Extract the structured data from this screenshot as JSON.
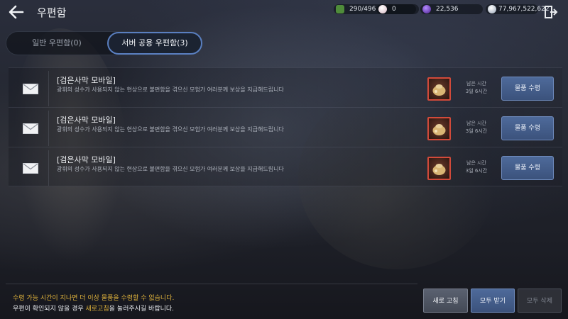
{
  "header": {
    "title": "우편함",
    "resources": [
      {
        "icon": "energy-icon",
        "value": "290/496",
        "color": "#4f8c3a"
      },
      {
        "icon": "pearl-icon",
        "value": "0",
        "color": "#e8d8dc"
      },
      {
        "icon": "crystal-icon",
        "value": "22,536",
        "color": "#7a3fc8"
      },
      {
        "icon": "silver-icon",
        "value": "77,967,522,622",
        "color": "#cfd6e0"
      }
    ]
  },
  "tabs": [
    {
      "label": "일반 우편함(0)",
      "active": false
    },
    {
      "label": "서버 공용 우편함(3)",
      "active": true
    }
  ],
  "mails": [
    {
      "sender": "[검은사막 모바일]",
      "message": "광휘의 성수가 사용되지 않는 현상으로 불편함을 겪으신 모험가 여러분께 보상을 지급해드립니다",
      "remain_label": "남은 시간",
      "remain_value": "3일 6시간",
      "claim_label": "물품 수령",
      "item_icon": "reward-pouch-icon"
    },
    {
      "sender": "[검은사막 모바일]",
      "message": "광휘의 성수가 사용되지 않는 현상으로 불편함을 겪으신 모험가 여러분께 보상을 지급해드립니다",
      "remain_label": "남은 시간",
      "remain_value": "3일 6시간",
      "claim_label": "물품 수령",
      "item_icon": "reward-pouch-icon"
    },
    {
      "sender": "[검은사막 모바일]",
      "message": "광휘의 성수가 사용되지 않는 현상으로 불편함을 겪으신 모험가 여러분께 보상을 지급해드립니다",
      "remain_label": "남은 시간",
      "remain_value": "3일 6시간",
      "claim_label": "물품 수령",
      "item_icon": "reward-pouch-icon"
    }
  ],
  "footer": {
    "notice_line1": "수령 가능 시간이 지나면 더 이상 물품을 수령할 수 없습니다.",
    "notice_line2_pre": "우편이 확인되지 않을 경우 ",
    "notice_line2_highlight": "새로고침",
    "notice_line2_post": "을 눌러주시길 바랍니다.",
    "refresh_label": "새로 고침",
    "receive_all_label": "모두 받기",
    "delete_all_label": "모두 삭제"
  },
  "colors": {
    "accent_blue": "#4e6a9a",
    "notice_yellow": "#e0b43c",
    "item_border": "#d24a3a"
  }
}
